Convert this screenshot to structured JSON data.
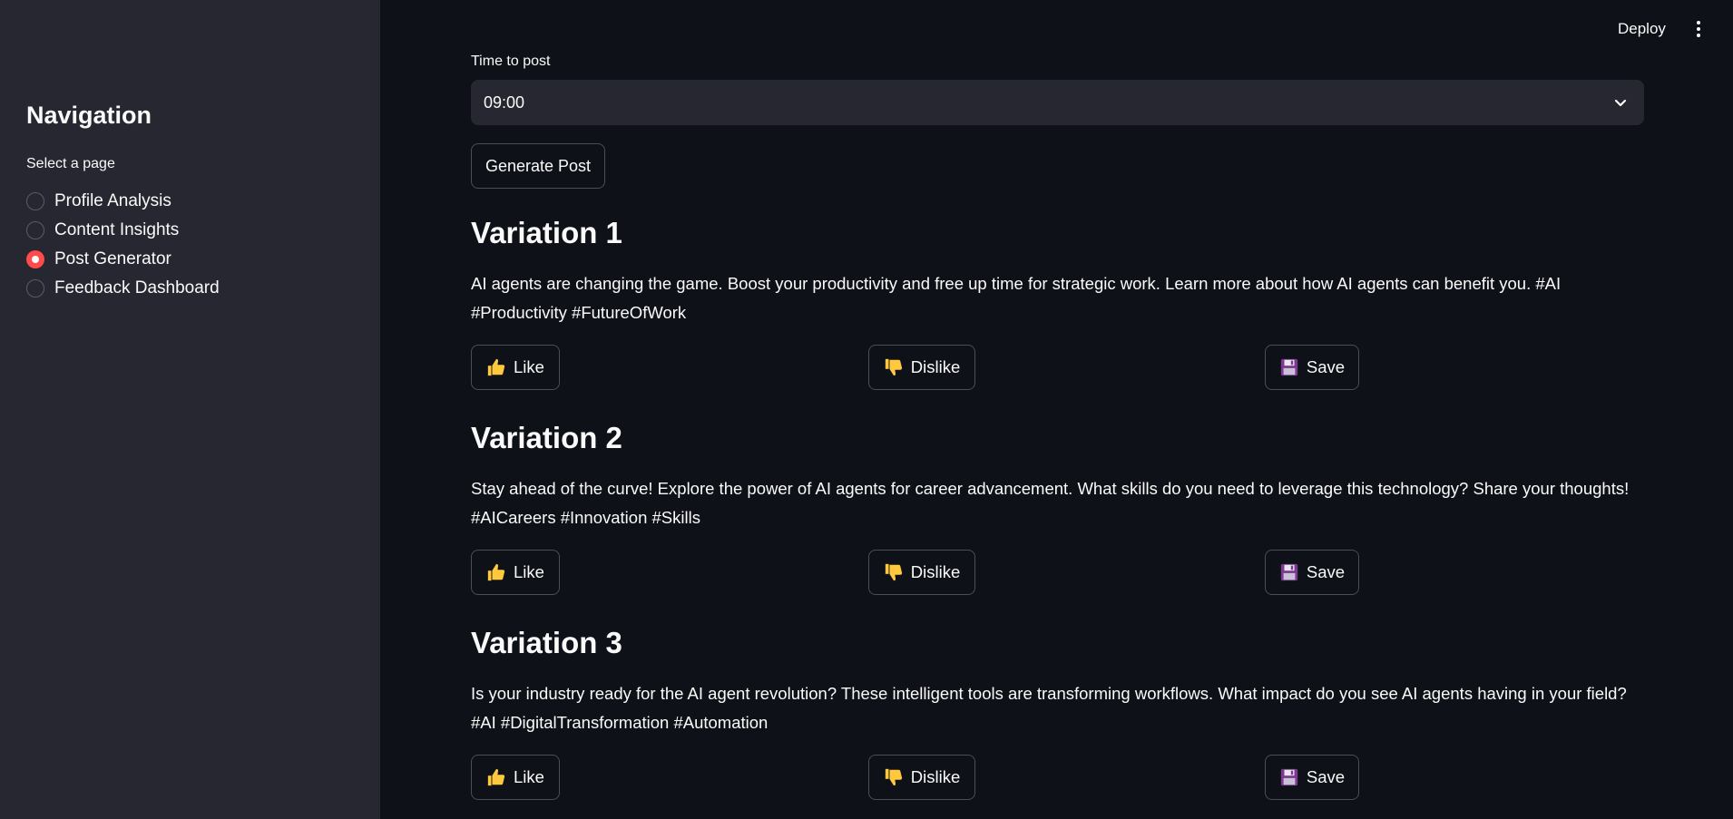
{
  "header": {
    "deploy_label": "Deploy"
  },
  "sidebar": {
    "title": "Navigation",
    "select_label": "Select a page",
    "items": [
      {
        "label": "Profile Analysis",
        "selected": false
      },
      {
        "label": "Content Insights",
        "selected": false
      },
      {
        "label": "Post Generator",
        "selected": true
      },
      {
        "label": "Feedback Dashboard",
        "selected": false
      }
    ]
  },
  "main": {
    "time_label": "Time to post",
    "time_value": "09:00",
    "generate_label": "Generate Post",
    "variations": [
      {
        "title": "Variation 1",
        "text": "AI agents are changing the game. Boost your productivity and free up time for strategic work. Learn more about how AI agents can benefit you. #AI #Productivity #FutureOfWork",
        "like_label": "Like",
        "dislike_label": "Dislike",
        "save_label": "Save"
      },
      {
        "title": "Variation 2",
        "text": "Stay ahead of the curve! Explore the power of AI agents for career advancement. What skills do you need to leverage this technology? Share your thoughts! #AICareers #Innovation #Skills",
        "like_label": "Like",
        "dislike_label": "Dislike",
        "save_label": "Save"
      },
      {
        "title": "Variation 3",
        "text": "Is your industry ready for the AI agent revolution? These intelligent tools are transforming workflows. What impact do you see AI agents having in your field? #AI #DigitalTransformation #Automation",
        "like_label": "Like",
        "dislike_label": "Dislike",
        "save_label": "Save"
      }
    ]
  },
  "colors": {
    "background": "#0e1117",
    "sidebar": "#262730",
    "accent": "#ff4b4b",
    "emoji": "#ffc83d",
    "save_icon": "#7b3a8f"
  },
  "icons": {
    "like": "thumbs-up-icon",
    "dislike": "thumbs-down-icon",
    "save": "floppy-disk-icon",
    "menu": "kebab-menu-icon",
    "select": "chevron-down-icon"
  }
}
